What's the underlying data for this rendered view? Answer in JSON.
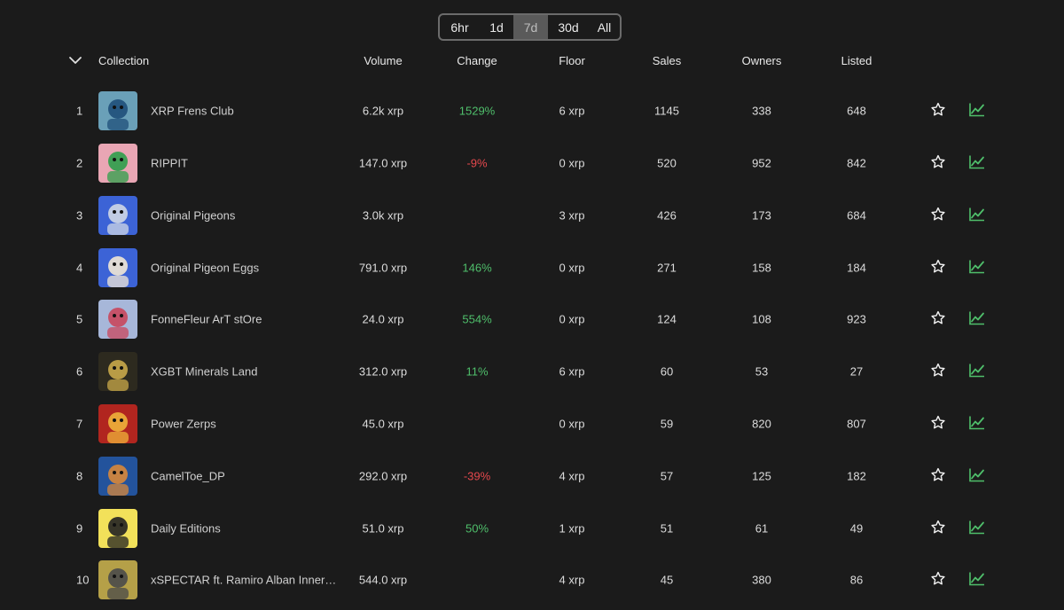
{
  "range": {
    "options": [
      "6hr",
      "1d",
      "7d",
      "30d",
      "All"
    ],
    "selected": "7d"
  },
  "table": {
    "headers": {
      "collection": "Collection",
      "volume": "Volume",
      "change": "Change",
      "floor": "Floor",
      "sales": "Sales",
      "owners": "Owners",
      "listed": "Listed"
    },
    "rows": [
      {
        "rank": "1",
        "name": "XRP Frens Club",
        "volume": "6.2k xrp",
        "change": "1529%",
        "change_dir": "up",
        "floor": "6 xrp",
        "sales": "1145",
        "owners": "338",
        "listed": "648"
      },
      {
        "rank": "2",
        "name": "RIPPIT",
        "volume": "147.0 xrp",
        "change": "-9%",
        "change_dir": "down",
        "floor": "0 xrp",
        "sales": "520",
        "owners": "952",
        "listed": "842"
      },
      {
        "rank": "3",
        "name": "Original Pigeons",
        "volume": "3.0k xrp",
        "change": "",
        "change_dir": "none",
        "floor": "3 xrp",
        "sales": "426",
        "owners": "173",
        "listed": "684"
      },
      {
        "rank": "4",
        "name": "Original Pigeon Eggs",
        "volume": "791.0 xrp",
        "change": "146%",
        "change_dir": "up",
        "floor": "0 xrp",
        "sales": "271",
        "owners": "158",
        "listed": "184"
      },
      {
        "rank": "5",
        "name": "FonneFleur ArT stOre",
        "volume": "24.0 xrp",
        "change": "554%",
        "change_dir": "up",
        "floor": "0 xrp",
        "sales": "124",
        "owners": "108",
        "listed": "923"
      },
      {
        "rank": "6",
        "name": "XGBT Minerals Land",
        "volume": "312.0 xrp",
        "change": "11%",
        "change_dir": "up",
        "floor": "6 xrp",
        "sales": "60",
        "owners": "53",
        "listed": "27"
      },
      {
        "rank": "7",
        "name": "Power Zerps",
        "volume": "45.0 xrp",
        "change": "",
        "change_dir": "none",
        "floor": "0 xrp",
        "sales": "59",
        "owners": "820",
        "listed": "807"
      },
      {
        "rank": "8",
        "name": "CamelToe_DP",
        "volume": "292.0 xrp",
        "change": "-39%",
        "change_dir": "down",
        "floor": "4 xrp",
        "sales": "57",
        "owners": "125",
        "listed": "182"
      },
      {
        "rank": "9",
        "name": "Daily Editions",
        "volume": "51.0 xrp",
        "change": "50%",
        "change_dir": "up",
        "floor": "1 xrp",
        "sales": "51",
        "owners": "61",
        "listed": "49"
      },
      {
        "rank": "10",
        "name": "xSPECTAR ft. Ramiro Alban Inner V...",
        "volume": "544.0 xrp",
        "change": "",
        "change_dir": "none",
        "floor": "4 xrp",
        "sales": "45",
        "owners": "380",
        "listed": "86"
      }
    ],
    "thumbs": [
      {
        "bg": "#6aa0b8",
        "fg": "#1f4f7a",
        "icon": "frog-chef-icon"
      },
      {
        "bg": "#e9a6b4",
        "fg": "#2e9f4a",
        "icon": "frog-icon"
      },
      {
        "bg": "#3c63d6",
        "fg": "#cfd7e6",
        "icon": "pigeon-icon"
      },
      {
        "bg": "#3c63d6",
        "fg": "#f1e7d5",
        "icon": "egg-icon"
      },
      {
        "bg": "#a7b7d9",
        "fg": "#c9475c",
        "icon": "portrait-icon"
      },
      {
        "bg": "#2d2a1f",
        "fg": "#c9a94a",
        "icon": "badge-icon"
      },
      {
        "bg": "#b1251f",
        "fg": "#f0b23a",
        "icon": "devil-icon"
      },
      {
        "bg": "#23539c",
        "fg": "#d8873a",
        "icon": "camel-icon"
      },
      {
        "bg": "#f2e15a",
        "fg": "#222222",
        "icon": "cup-icon"
      },
      {
        "bg": "#b5a048",
        "fg": "#4a4a4a",
        "icon": "face-art-icon"
      }
    ]
  },
  "colors": {
    "background": "#1b1b1b",
    "positive": "#4fbf6b",
    "negative": "#e5484d",
    "chart_icon": "#4fbf6b"
  }
}
